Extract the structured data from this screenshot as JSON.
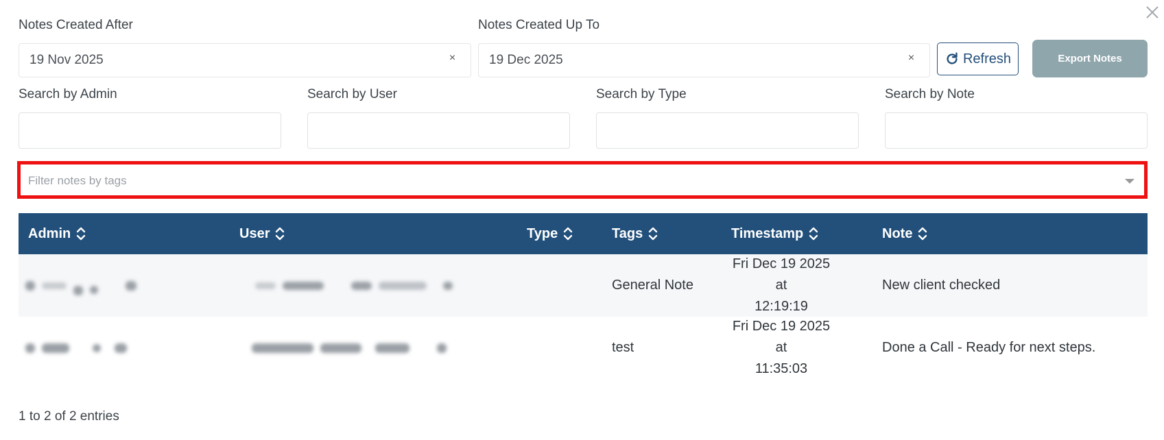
{
  "dialog": {
    "close_icon": "close-icon"
  },
  "date_range": {
    "after_label": "Notes Created After",
    "after_value": "19 Nov 2025",
    "upto_label": "Notes Created Up To",
    "upto_value": "19 Dec 2025",
    "clear_glyph": "×"
  },
  "actions": {
    "refresh_label": "Refresh",
    "export_label": "Export Notes"
  },
  "search": {
    "admin_label": "Search by Admin",
    "user_label": "Search by User",
    "type_label": "Search by Type",
    "note_label": "Search by Note"
  },
  "tags_filter": {
    "placeholder": "Filter notes by tags"
  },
  "table": {
    "columns": [
      "Admin",
      "User",
      "Type",
      "Tags",
      "Timestamp",
      "Note"
    ],
    "rows": [
      {
        "tags": "General Note",
        "timestamp_date": "Fri Dec 19 2025 at",
        "timestamp_time": "12:19:19",
        "note": "New client checked"
      },
      {
        "tags": "test",
        "timestamp_date": "Fri Dec 19 2025 at",
        "timestamp_time": "11:35:03",
        "note": "Done a Call - Ready for next steps."
      }
    ]
  },
  "footer": {
    "entries": "1 to 2 of 2 entries"
  },
  "colors": {
    "header_bg": "#22507b",
    "export_bg": "#8fa6ad",
    "highlight": "#ee1111"
  }
}
